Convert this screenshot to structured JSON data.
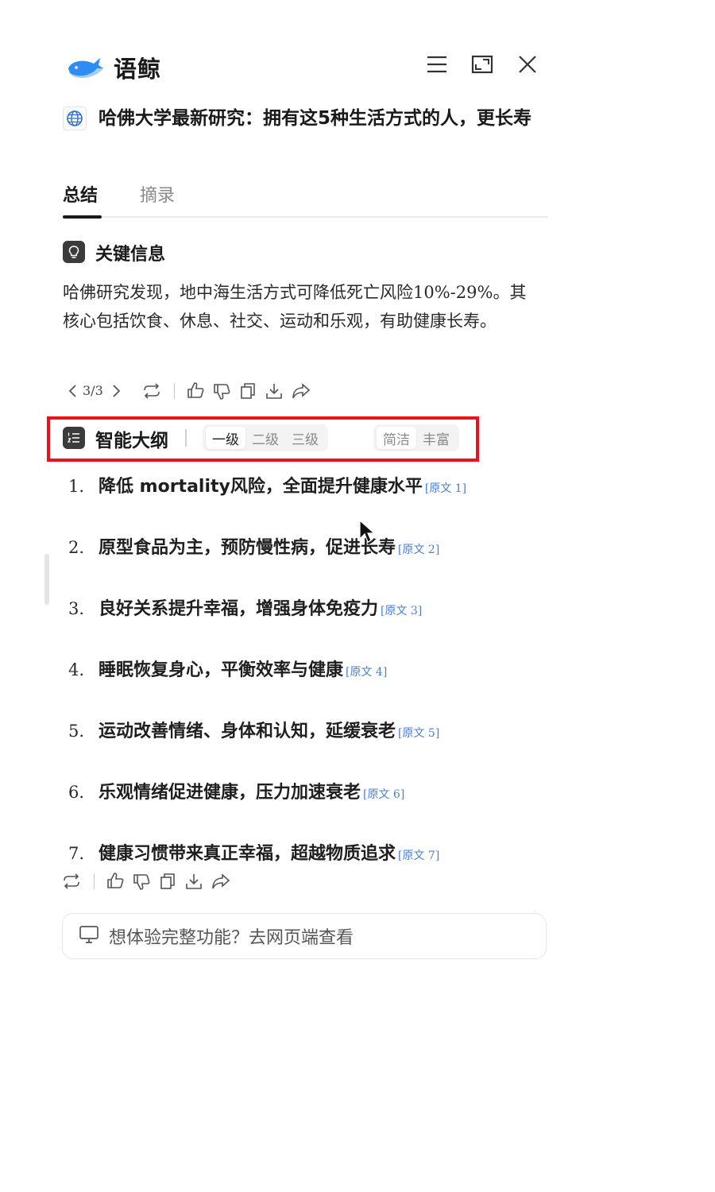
{
  "app": {
    "name": "语鲸"
  },
  "header": {
    "icons": [
      "menu-icon",
      "expand-icon",
      "close-icon"
    ]
  },
  "article": {
    "title": "哈佛大学最新研究：拥有这5种生活方式的人，更长寿"
  },
  "tabs": [
    {
      "label": "总结"
    },
    {
      "label": "摘录"
    }
  ],
  "key_info": {
    "title": "关键信息",
    "summary": "哈佛研究发现，地中海生活方式可降低死亡风险10%-29%。其核心包括饮食、休息、社交、运动和乐观，有助健康长寿。",
    "pager": "3/3"
  },
  "outline": {
    "title": "智能大纲",
    "levels": [
      "一级",
      "二级",
      "三级"
    ],
    "level_selected": "一级",
    "styles": [
      "简洁",
      "丰富"
    ],
    "style_selected": "简洁",
    "items": [
      {
        "num": "1.",
        "text": "降低 mortality风险，全面提升健康水平",
        "ref": "[原文 1]"
      },
      {
        "num": "2.",
        "text": "原型食品为主，预防慢性病，促进长寿",
        "ref": "[原文 2]"
      },
      {
        "num": "3.",
        "text": "良好关系提升幸福，增强身体免疫力",
        "ref": "[原文 3]"
      },
      {
        "num": "4.",
        "text": "睡眠恢复身心，平衡效率与健康",
        "ref": "[原文 4]"
      },
      {
        "num": "5.",
        "text": "运动改善情绪、身体和认知，延缓衰老",
        "ref": "[原文 5]"
      },
      {
        "num": "6.",
        "text": "乐观情绪促进健康，压力加速衰老",
        "ref": "[原文 6]"
      },
      {
        "num": "7.",
        "text": "健康习惯带来真正幸福，超越物质追求",
        "ref": "[原文 7]"
      }
    ]
  },
  "cta": {
    "text": "想体验完整功能？去网页端查看"
  },
  "colors": {
    "highlight": "#e8121a",
    "ref_link": "#4a7fd6",
    "logo_blue": "#2f8cf0"
  }
}
